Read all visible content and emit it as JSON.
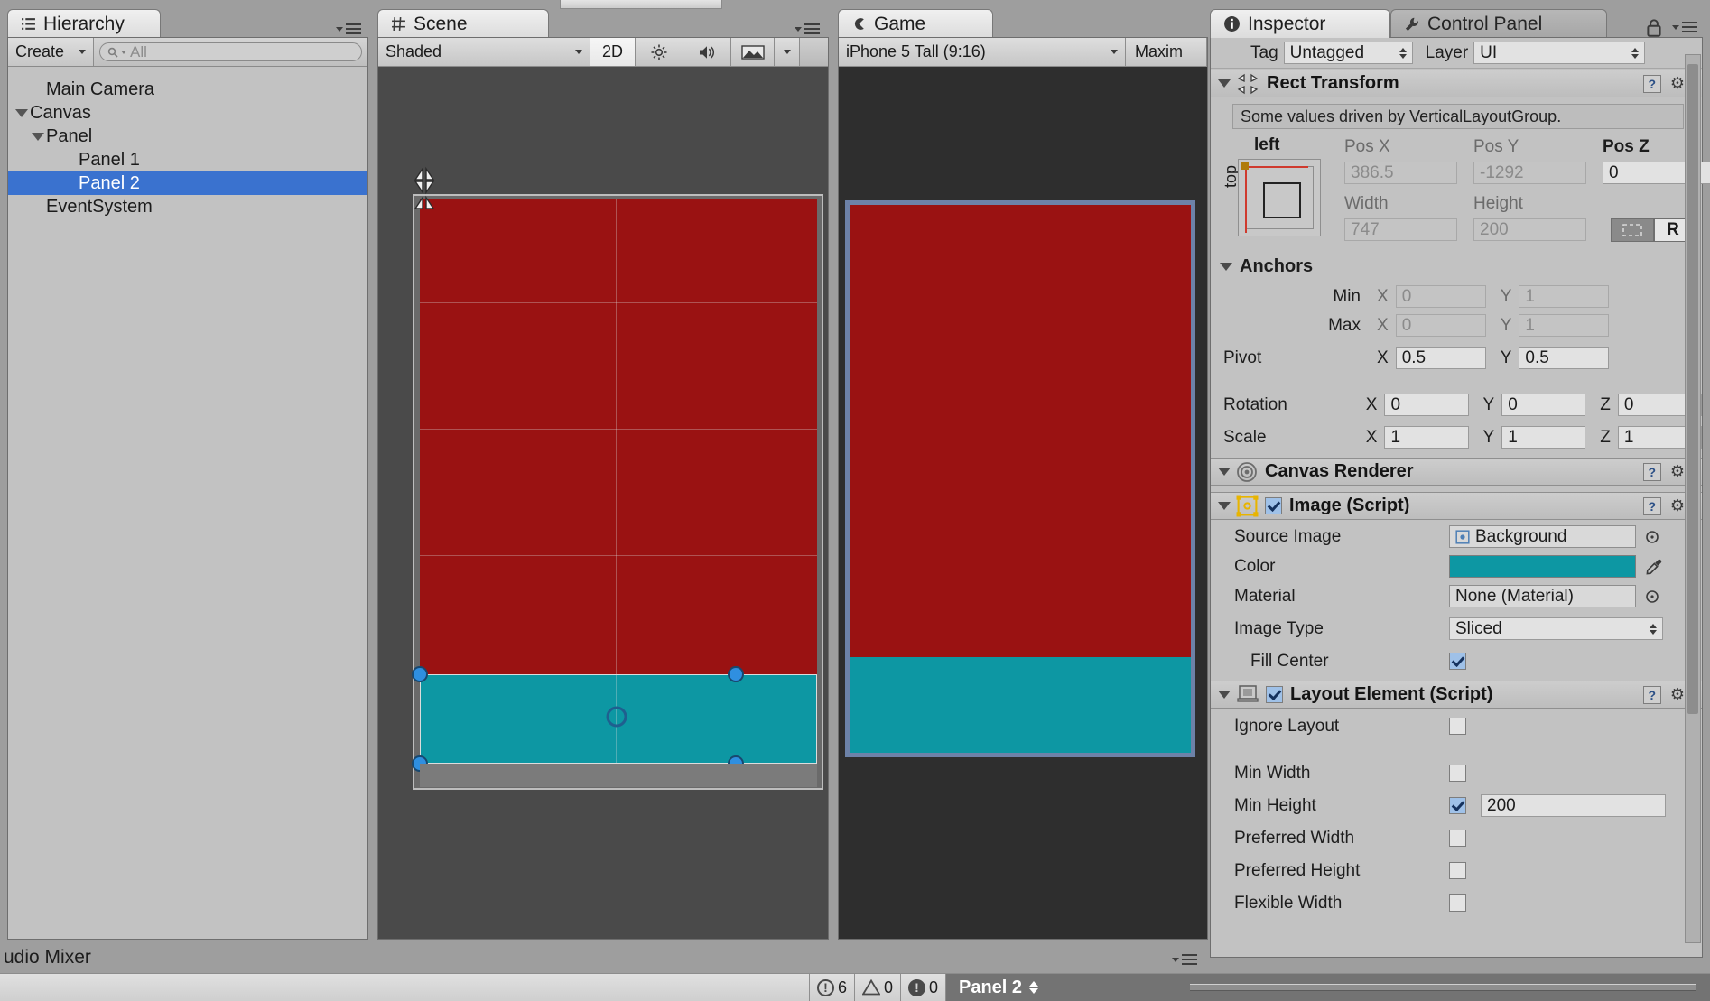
{
  "hierarchy": {
    "tab_label": "Hierarchy",
    "tab_icon": "hierarchy-icon",
    "create_label": "Create",
    "search_placeholder": "All",
    "items": [
      {
        "label": "Main Camera",
        "depth": 1,
        "expandable": false,
        "selected": false
      },
      {
        "label": "Canvas",
        "depth": 0,
        "expandable": true,
        "selected": false
      },
      {
        "label": "Panel",
        "depth": 1,
        "expandable": true,
        "selected": false
      },
      {
        "label": "Panel 1",
        "depth": 2,
        "expandable": false,
        "selected": false
      },
      {
        "label": "Panel 2",
        "depth": 2,
        "expandable": false,
        "selected": true
      },
      {
        "label": "EventSystem",
        "depth": 1,
        "expandable": false,
        "selected": false
      }
    ]
  },
  "scene": {
    "tab_label": "Scene",
    "tab_icon": "scene-grid-icon",
    "draw_mode": "Shaded",
    "mode_2d": "2D",
    "lighting_icon": "sun-icon",
    "audio_icon": "speaker-icon",
    "effects_icon": "image-icon",
    "colors": {
      "background": "#4a4a4a",
      "panel_red": "#9a1212",
      "panel_teal": "#0d97a3",
      "selection_outline": "#d9d9d9",
      "handle_blue": "#2f8fe0"
    }
  },
  "game": {
    "tab_label": "Game",
    "tab_icon": "game-icon",
    "aspect": "iPhone 5 Tall (9:16)",
    "maximize_label": "Maxim",
    "colors": {
      "letterbox": "#2e2e2e",
      "panel_red": "#9a1212",
      "panel_teal": "#0d97a3",
      "canvas_border": "#6d82a8"
    }
  },
  "inspector": {
    "tab_label": "Inspector",
    "tab_icon": "info-icon",
    "control_panel_tab": "Control Panel",
    "control_panel_icon": "wrench-icon",
    "lock_icon": "lock-icon",
    "tag_label": "Tag",
    "tag_value": "Untagged",
    "layer_label": "Layer",
    "layer_value": "UI",
    "rect_transform": {
      "title": "Rect Transform",
      "icon": "rect-transform-icon",
      "driven_note": "Some values driven by VerticalLayoutGroup.",
      "anchor_preset_top": "left",
      "anchor_preset_side": "top",
      "blueprint_label": "R",
      "pos_x_label": "Pos X",
      "pos_x_value": "386.5",
      "pos_y_label": "Pos Y",
      "pos_y_value": "-1292",
      "pos_z_label": "Pos Z",
      "pos_z_value": "0",
      "width_label": "Width",
      "width_value": "747",
      "height_label": "Height",
      "height_value": "200",
      "anchors_label": "Anchors",
      "min_label": "Min",
      "min_x": "0",
      "min_y": "1",
      "max_label": "Max",
      "max_x": "0",
      "max_y": "1",
      "pivot_label": "Pivot",
      "pivot_x": "0.5",
      "pivot_y": "0.5",
      "rotation_label": "Rotation",
      "rotation_x": "0",
      "rotation_y": "0",
      "rotation_z": "0",
      "scale_label": "Scale",
      "scale_x": "1",
      "scale_y": "1",
      "scale_z": "1",
      "axis_x": "X",
      "axis_y": "Y",
      "axis_z": "Z"
    },
    "canvas_renderer": {
      "title": "Canvas Renderer",
      "icon": "canvas-renderer-icon"
    },
    "image_script": {
      "title": "Image (Script)",
      "icon": "image-component-icon",
      "enabled": true,
      "source_image_label": "Source Image",
      "source_image_value": "Background",
      "color_label": "Color",
      "color_value": "#0d97a3",
      "eyedropper_icon": "eyedropper-icon",
      "material_label": "Material",
      "material_value": "None (Material)",
      "image_type_label": "Image Type",
      "image_type_value": "Sliced",
      "fill_center_label": "Fill Center",
      "fill_center_checked": true
    },
    "layout_element": {
      "title": "Layout Element (Script)",
      "icon": "layout-element-icon",
      "enabled": true,
      "rows": [
        {
          "label": "Ignore Layout",
          "checked": false,
          "value": null
        },
        {
          "label": "Min Width",
          "checked": false,
          "value": null
        },
        {
          "label": "Min Height",
          "checked": true,
          "value": "200"
        },
        {
          "label": "Preferred Width",
          "checked": false,
          "value": null
        },
        {
          "label": "Preferred Height",
          "checked": false,
          "value": null
        },
        {
          "label": "Flexible Width",
          "checked": false,
          "value": null
        }
      ]
    }
  },
  "bottom": {
    "project_tab_label": "udio Mixer",
    "errors": "6",
    "warnings": "0",
    "logs": "0",
    "selected_object": "Panel 2"
  }
}
